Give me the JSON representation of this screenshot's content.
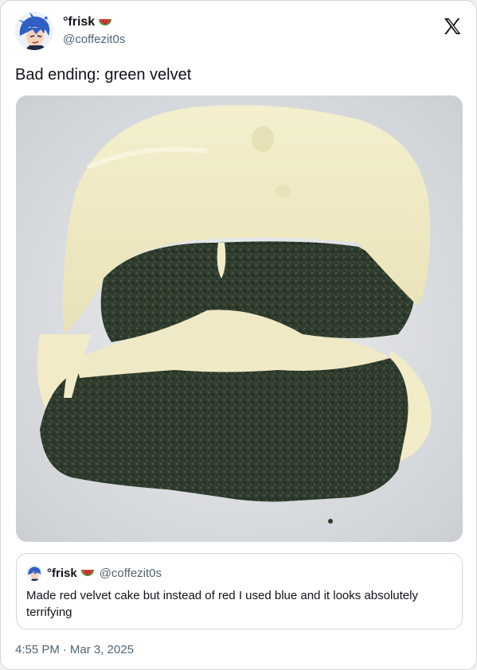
{
  "author": {
    "display_name": "°frisk",
    "emoji": "watermelon-slice",
    "handle": "@coffezit0s",
    "avatar": "anime-character-blue-hair-avatar"
  },
  "logo": "x-logo",
  "tweet": {
    "text": "Bad ending: green velvet"
  },
  "photo": {
    "subject": "slice of dark green cake with cream cheese frosting on white plate"
  },
  "quoted_tweet": {
    "display_name": "°frisk",
    "handle": "@coffezit0s",
    "text": "Made red velvet cake but instead of red I used blue and it looks absolutely terrifying"
  },
  "timestamp": {
    "time": "4:55 PM",
    "separator": "·",
    "date": "Mar 3, 2025"
  },
  "colors": {
    "text": "#0f1419",
    "secondary": "#536471",
    "border": "#cfd9de",
    "watermelon_red": "#e23b3b",
    "watermelon_green": "#3a9a3a"
  }
}
